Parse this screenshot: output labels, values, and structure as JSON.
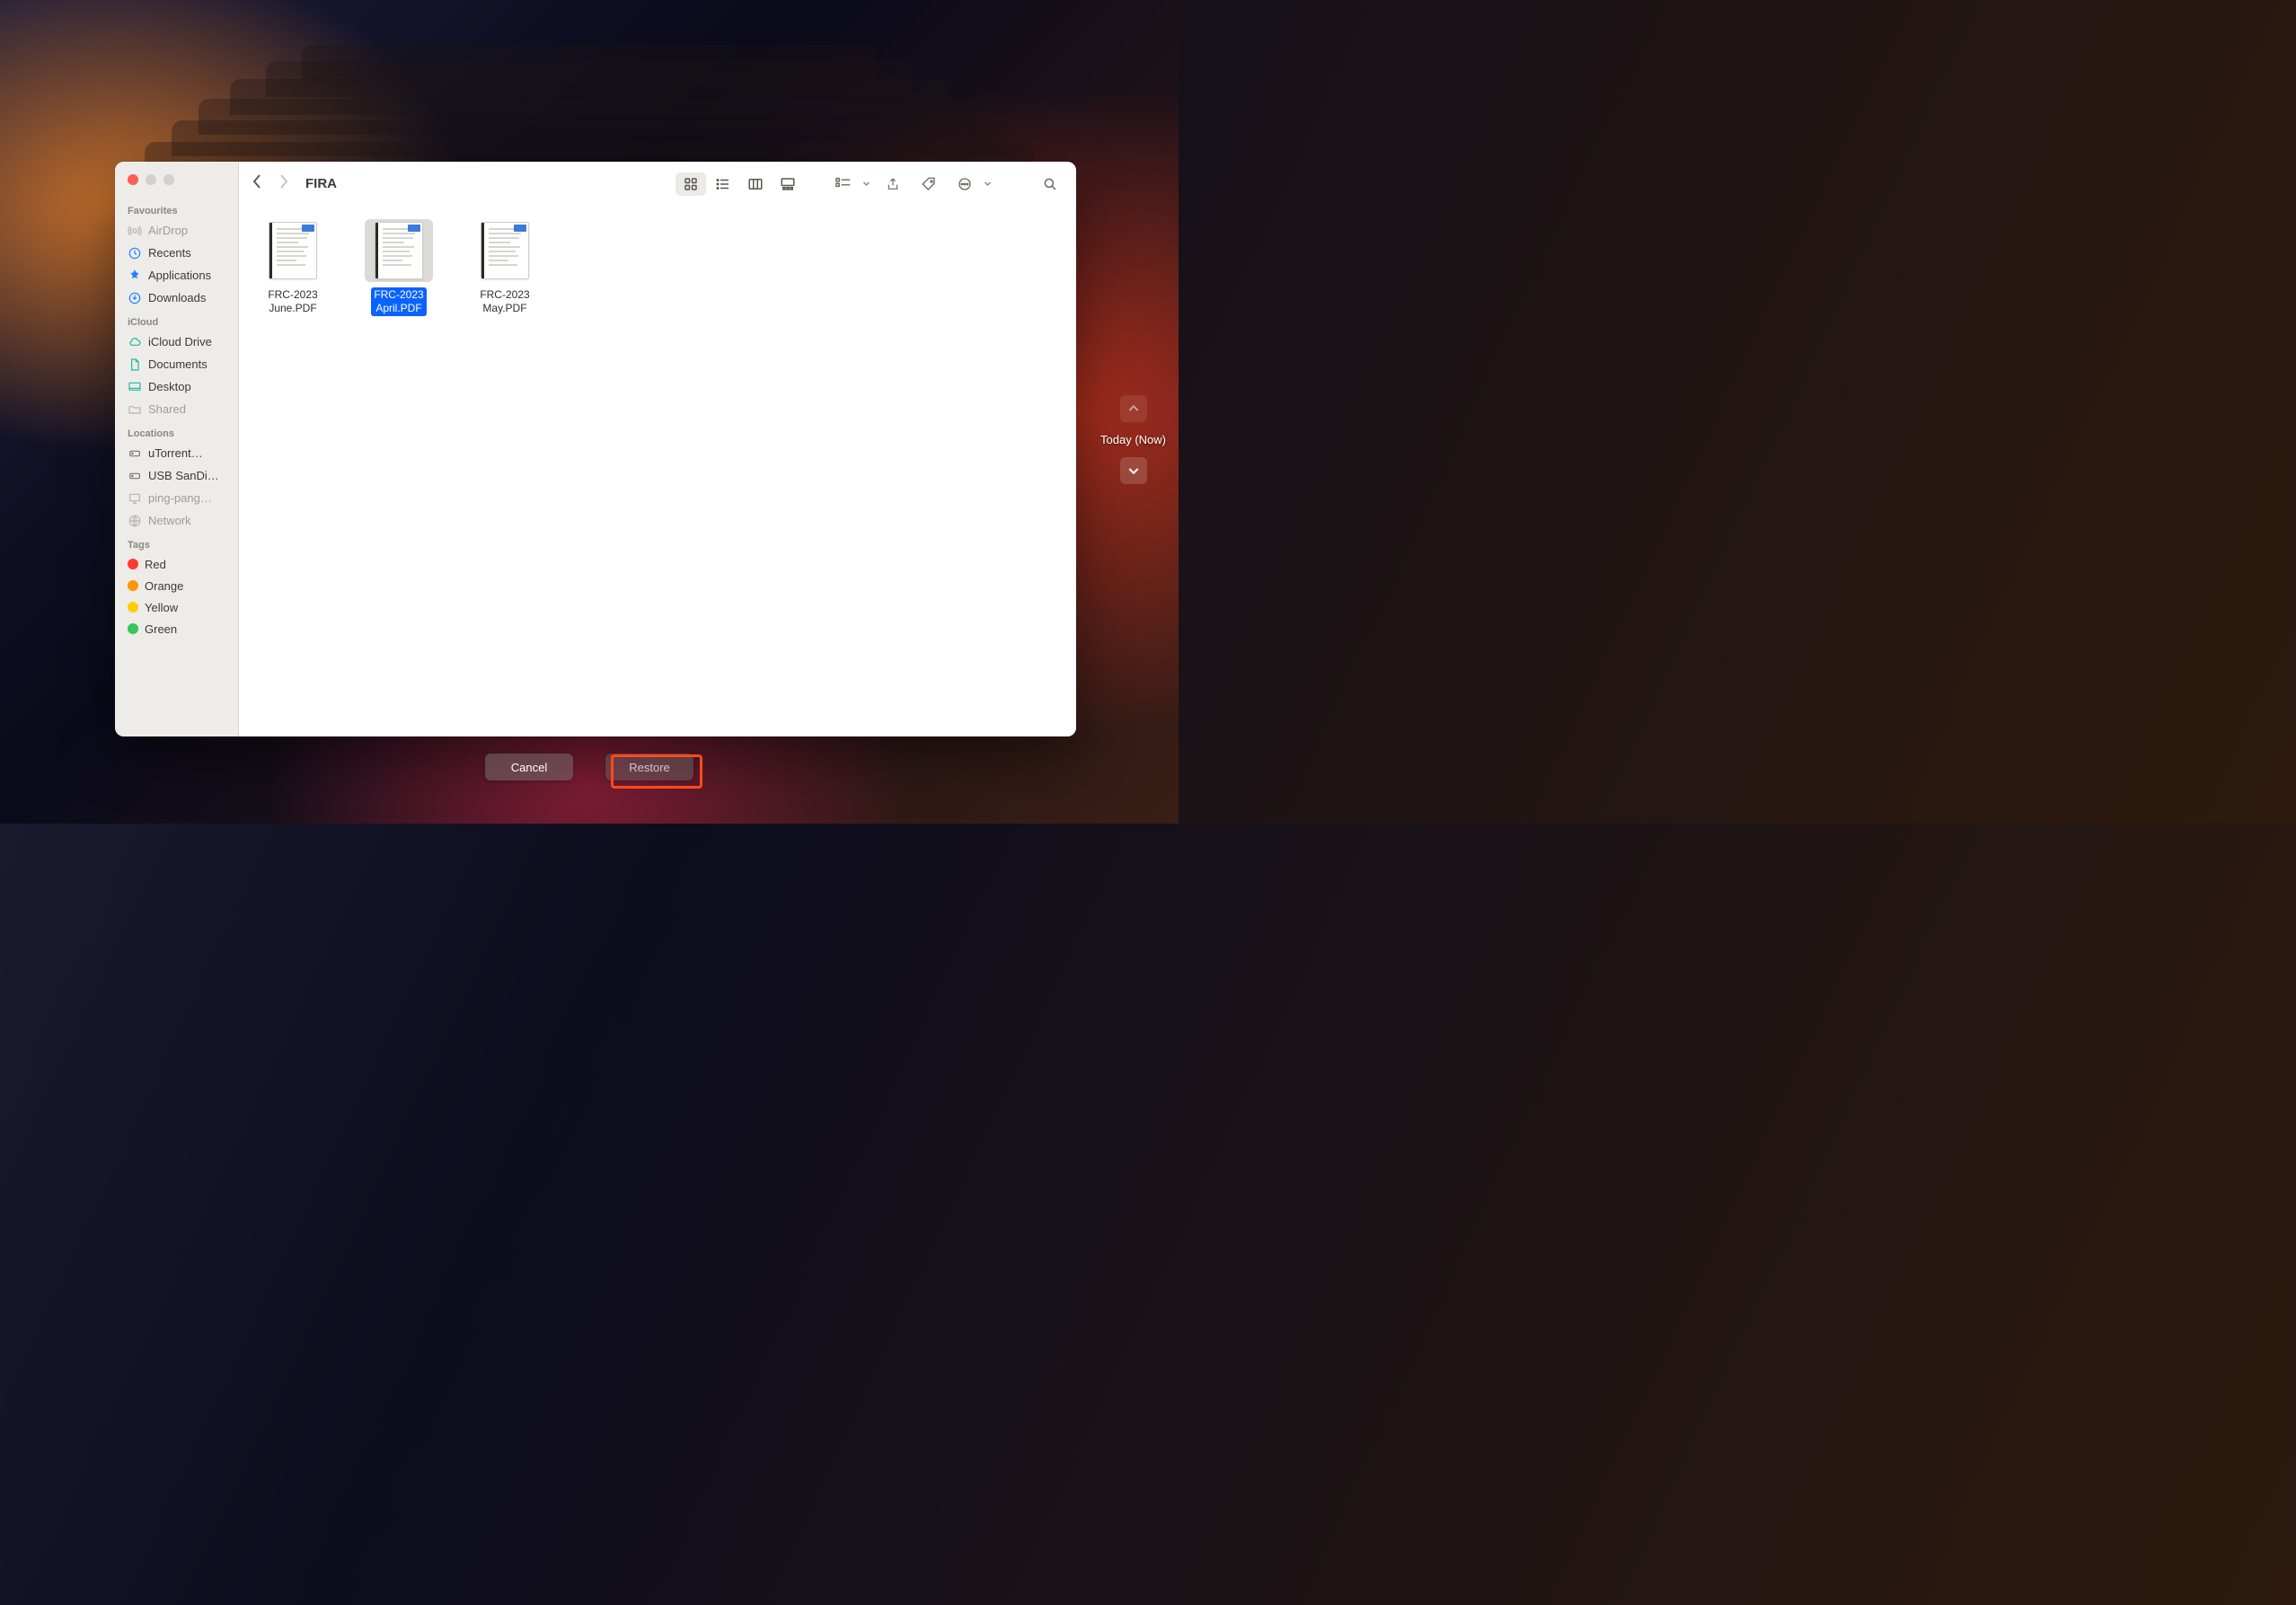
{
  "window": {
    "folder_title": "FIRA"
  },
  "sidebar": {
    "sections": [
      {
        "heading": "Favourites",
        "items": [
          {
            "label": "AirDrop",
            "icon": "airdrop-icon",
            "muted": true
          },
          {
            "label": "Recents",
            "icon": "clock-icon"
          },
          {
            "label": "Applications",
            "icon": "apps-icon"
          },
          {
            "label": "Downloads",
            "icon": "download-icon"
          }
        ]
      },
      {
        "heading": "iCloud",
        "items": [
          {
            "label": "iCloud Drive",
            "icon": "cloud-icon"
          },
          {
            "label": "Documents",
            "icon": "document-icon"
          },
          {
            "label": "Desktop",
            "icon": "desktop-icon"
          },
          {
            "label": "Shared",
            "icon": "folder-icon",
            "muted": true
          }
        ]
      },
      {
        "heading": "Locations",
        "items": [
          {
            "label": "uTorrent…",
            "icon": "disk-icon"
          },
          {
            "label": "USB SanDi…",
            "icon": "disk-icon"
          },
          {
            "label": "ping-pang…",
            "icon": "computer-icon",
            "muted": true
          },
          {
            "label": "Network",
            "icon": "globe-icon",
            "muted": true
          }
        ]
      },
      {
        "heading": "Tags",
        "items": [
          {
            "label": "Red",
            "tag_color": "#ff3b30"
          },
          {
            "label": "Orange",
            "tag_color": "#ff9500"
          },
          {
            "label": "Yellow",
            "tag_color": "#ffcc00"
          },
          {
            "label": "Green",
            "tag_color": "#34c759"
          }
        ]
      }
    ]
  },
  "files": [
    {
      "line1": "FRC-2023",
      "line2": "June.PDF",
      "selected": false
    },
    {
      "line1": "FRC-2023",
      "line2": "April.PDF",
      "selected": true
    },
    {
      "line1": "FRC-2023",
      "line2": "May.PDF",
      "selected": false
    }
  ],
  "timeline": {
    "label": "Today (Now)"
  },
  "actions": {
    "cancel": "Cancel",
    "restore": "Restore"
  }
}
